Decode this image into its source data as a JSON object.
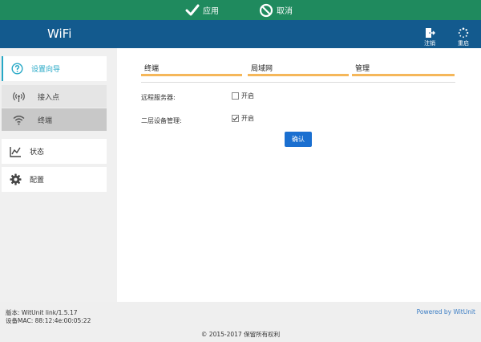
{
  "topbar": {
    "apply_label": "应用",
    "cancel_label": "取消",
    "color": "#1f8a5e"
  },
  "header": {
    "brand": "WiFi",
    "logout_label": "注销",
    "restart_label": "重启",
    "color": "#135a8e"
  },
  "sidebar": {
    "wizard": {
      "label": "设置向导",
      "icon": "question-circle-icon",
      "color": "#26a8c6"
    },
    "sub_items": [
      {
        "label": "接入点",
        "icon": "broadcast-icon"
      },
      {
        "label": "终端",
        "icon": "wifi-icon"
      }
    ],
    "status": {
      "label": "状态",
      "icon": "line-chart-icon"
    },
    "config": {
      "label": "配置",
      "icon": "gear-icon"
    }
  },
  "main": {
    "tabs": [
      {
        "label": "终端"
      },
      {
        "label": "局域网"
      },
      {
        "label": "管理"
      }
    ],
    "tab_underline_color": "#f5b75a",
    "remote_server": {
      "label": "远程服务器:",
      "option_label": "开启",
      "checked": false
    },
    "l2_management": {
      "label": "二层设备管理:",
      "option_label": "开启",
      "checked": true
    },
    "confirm_label": "确认"
  },
  "footer": {
    "version": "版本: WitUnit link/1.5.17",
    "mac": "设备MAC: 88:12:4e:00:05:22",
    "powered_by": "Powered by WitUnit",
    "copyright": "© 2015-2017 保留所有权利"
  }
}
